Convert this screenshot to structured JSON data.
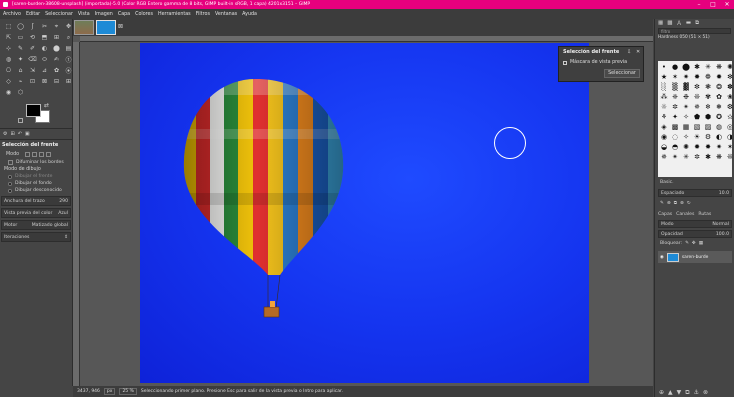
{
  "window": {
    "title": "[saren-burden-38608-unsplash] (importada)-5.0 (Color RGB Entero gamma de 8 bits, GIMP built-in sRGB, 1 capa) 4201x3151 – GIMP",
    "controls": [
      "–",
      "□",
      "✕"
    ]
  },
  "menu": [
    "Archivo",
    "Editar",
    "Seleccionar",
    "Vista",
    "Imagen",
    "Capa",
    "Colores",
    "Herramientas",
    "Filtros",
    "Ventanas",
    "Ayuda"
  ],
  "toolbox": {
    "tools": [
      "⬚",
      "◯",
      "ʃ",
      "✂",
      "⌖",
      "✥",
      "⇱",
      "▭",
      "⟲",
      "⬒",
      "⊞",
      "⌕",
      "⊹",
      "✎",
      "✐",
      "◐",
      "⬤",
      "▤",
      "◍",
      "✦",
      "⌫",
      "⬭",
      "✍",
      "ⓣ",
      "⎔",
      "⌂",
      "⇲",
      "⊿",
      "✿",
      "⦿",
      "◇",
      "⌁",
      "⊡",
      "⊠",
      "⊟",
      "⊞",
      "◉",
      "⬡"
    ],
    "title": "Selección del frente",
    "mode_label": "Modo",
    "feather": "Difuminar los bordes",
    "draw_mode_label": "Modo de dibujo",
    "draw_modes": [
      {
        "label": "Dibujar el frente",
        "disabled": true
      },
      {
        "label": "Dibujar el fondo",
        "disabled": false
      },
      {
        "label": "Dibujar desconocido",
        "disabled": false
      }
    ],
    "stroke_width_label": "Anchura del trazo",
    "stroke_width_value": "290",
    "preview_color": "Vista previa del color",
    "preview_color_value": "Azul",
    "engine_label": "Motor",
    "engine_value": "Matizado global",
    "iterations_label": "Iteraciones"
  },
  "image_tabs": {
    "close_icon": "⊠"
  },
  "fs_panel": {
    "title": "Selección del frente",
    "preview_mask": "Máscara de vista previa",
    "select_button": "Seleccionar"
  },
  "status": {
    "coords": "3437, 946",
    "unit": "px",
    "zoom": "25 %",
    "message": "Seleccionando primer plano. Presione Esc para salir de la vista previa o Intro para aplicar."
  },
  "right_dock": {
    "filter_placeholder": "filtro",
    "brush_name": "Hardness 050 (51 × 51)",
    "brush_glyphs": [
      "•",
      "●",
      "⬤",
      "✱",
      "✳",
      "❋",
      "✺",
      "★",
      "✶",
      "✷",
      "✸",
      "❁",
      "✹",
      "✻",
      "░",
      "▒",
      "▓",
      "✼",
      "❃",
      "❂",
      "✽",
      "⁂",
      "❈",
      "❉",
      "❊",
      "✾",
      "✿",
      "❀",
      "☼",
      "✲",
      "✴",
      "✵",
      "❄",
      "❅",
      "❆",
      "⚘",
      "✦",
      "✧",
      "⬟",
      "⬢",
      "✪",
      "✫",
      "◈",
      "▩",
      "▦",
      "▧",
      "▨",
      "◍",
      "◎",
      "◉",
      "◌",
      "✧",
      "☀",
      "⚙",
      "◐",
      "◑",
      "◒",
      "◓",
      "✺",
      "✹",
      "✸",
      "✷",
      "✶",
      "✵",
      "✴",
      "✳",
      "✲",
      "✱",
      "❋",
      "❊"
    ],
    "preset_label": "Basic.",
    "spacing_label": "Espaciado",
    "spacing_value": "10.0",
    "tabs": [
      "Capas",
      "Canales",
      "Rutas"
    ],
    "mode_label": "Modo",
    "mode_value": "Normal",
    "opacity_label": "Opacidad",
    "opacity_value": "100.0",
    "lock_label": "Bloquear:",
    "layer_name": "saren-burde"
  }
}
